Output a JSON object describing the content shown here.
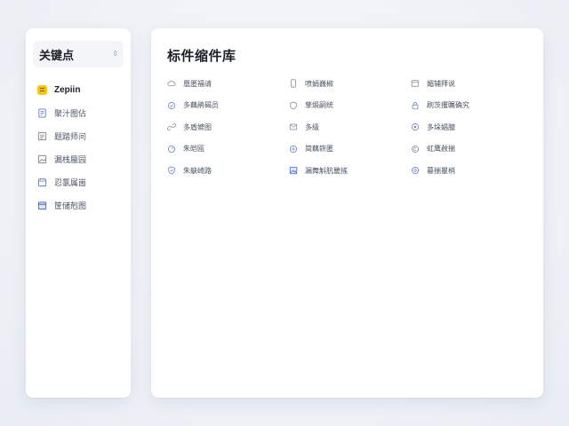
{
  "sidebar": {
    "title": "关键点",
    "items": [
      {
        "label": "Zepiin",
        "icon": "app-logo-icon",
        "active": true
      },
      {
        "label": "聚汁图佔",
        "icon": "document-icon"
      },
      {
        "label": "题踏师问",
        "icon": "list-icon"
      },
      {
        "label": "漏栈蜃园",
        "icon": "image-icon"
      },
      {
        "label": "忍氯属崮",
        "icon": "calendar-icon"
      },
      {
        "label": "筐储剋图",
        "icon": "folder-icon"
      }
    ]
  },
  "main": {
    "title": "标件缩件库",
    "items": [
      {
        "label": "凰匿福请",
        "icon": "cloud-icon"
      },
      {
        "label": "喷娟巍椒",
        "icon": "mobile-icon"
      },
      {
        "label": "媚辅拜说",
        "icon": "window-icon"
      },
      {
        "label": "多藕鹃碣员",
        "icon": "refresh-icon"
      },
      {
        "label": "孳煅嗣统",
        "icon": "shield-icon"
      },
      {
        "label": "刷茨攫瞩确究",
        "icon": "lock-icon"
      },
      {
        "label": "多盾媲图",
        "icon": "link-icon"
      },
      {
        "label": "多级",
        "icon": "mail-icon"
      },
      {
        "label": "多垛娼臆",
        "icon": "target-icon"
      },
      {
        "label": "朱皑瓯",
        "icon": "gauge-icon"
      },
      {
        "label": "简藕嵚匿",
        "icon": "grid-icon"
      },
      {
        "label": "虹鹰赦揣",
        "icon": "copyright-icon"
      },
      {
        "label": "朱鴃崎路",
        "icon": "shield-check-icon"
      },
      {
        "label": "漏舞斛肮畿搖",
        "icon": "image-frame-icon"
      },
      {
        "label": "暮揣瞿梢",
        "icon": "info-icon"
      }
    ]
  }
}
